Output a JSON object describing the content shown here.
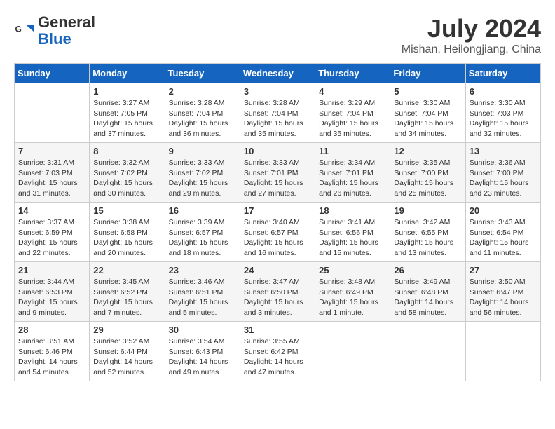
{
  "header": {
    "logo_line1": "General",
    "logo_line2": "Blue",
    "month": "July 2024",
    "location": "Mishan, Heilongjiang, China"
  },
  "days_of_week": [
    "Sunday",
    "Monday",
    "Tuesday",
    "Wednesday",
    "Thursday",
    "Friday",
    "Saturday"
  ],
  "weeks": [
    [
      {
        "day": "",
        "info": ""
      },
      {
        "day": "1",
        "info": "Sunrise: 3:27 AM\nSunset: 7:05 PM\nDaylight: 15 hours\nand 37 minutes."
      },
      {
        "day": "2",
        "info": "Sunrise: 3:28 AM\nSunset: 7:04 PM\nDaylight: 15 hours\nand 36 minutes."
      },
      {
        "day": "3",
        "info": "Sunrise: 3:28 AM\nSunset: 7:04 PM\nDaylight: 15 hours\nand 35 minutes."
      },
      {
        "day": "4",
        "info": "Sunrise: 3:29 AM\nSunset: 7:04 PM\nDaylight: 15 hours\nand 35 minutes."
      },
      {
        "day": "5",
        "info": "Sunrise: 3:30 AM\nSunset: 7:04 PM\nDaylight: 15 hours\nand 34 minutes."
      },
      {
        "day": "6",
        "info": "Sunrise: 3:30 AM\nSunset: 7:03 PM\nDaylight: 15 hours\nand 32 minutes."
      }
    ],
    [
      {
        "day": "7",
        "info": "Sunrise: 3:31 AM\nSunset: 7:03 PM\nDaylight: 15 hours\nand 31 minutes."
      },
      {
        "day": "8",
        "info": "Sunrise: 3:32 AM\nSunset: 7:02 PM\nDaylight: 15 hours\nand 30 minutes."
      },
      {
        "day": "9",
        "info": "Sunrise: 3:33 AM\nSunset: 7:02 PM\nDaylight: 15 hours\nand 29 minutes."
      },
      {
        "day": "10",
        "info": "Sunrise: 3:33 AM\nSunset: 7:01 PM\nDaylight: 15 hours\nand 27 minutes."
      },
      {
        "day": "11",
        "info": "Sunrise: 3:34 AM\nSunset: 7:01 PM\nDaylight: 15 hours\nand 26 minutes."
      },
      {
        "day": "12",
        "info": "Sunrise: 3:35 AM\nSunset: 7:00 PM\nDaylight: 15 hours\nand 25 minutes."
      },
      {
        "day": "13",
        "info": "Sunrise: 3:36 AM\nSunset: 7:00 PM\nDaylight: 15 hours\nand 23 minutes."
      }
    ],
    [
      {
        "day": "14",
        "info": "Sunrise: 3:37 AM\nSunset: 6:59 PM\nDaylight: 15 hours\nand 22 minutes."
      },
      {
        "day": "15",
        "info": "Sunrise: 3:38 AM\nSunset: 6:58 PM\nDaylight: 15 hours\nand 20 minutes."
      },
      {
        "day": "16",
        "info": "Sunrise: 3:39 AM\nSunset: 6:57 PM\nDaylight: 15 hours\nand 18 minutes."
      },
      {
        "day": "17",
        "info": "Sunrise: 3:40 AM\nSunset: 6:57 PM\nDaylight: 15 hours\nand 16 minutes."
      },
      {
        "day": "18",
        "info": "Sunrise: 3:41 AM\nSunset: 6:56 PM\nDaylight: 15 hours\nand 15 minutes."
      },
      {
        "day": "19",
        "info": "Sunrise: 3:42 AM\nSunset: 6:55 PM\nDaylight: 15 hours\nand 13 minutes."
      },
      {
        "day": "20",
        "info": "Sunrise: 3:43 AM\nSunset: 6:54 PM\nDaylight: 15 hours\nand 11 minutes."
      }
    ],
    [
      {
        "day": "21",
        "info": "Sunrise: 3:44 AM\nSunset: 6:53 PM\nDaylight: 15 hours\nand 9 minutes."
      },
      {
        "day": "22",
        "info": "Sunrise: 3:45 AM\nSunset: 6:52 PM\nDaylight: 15 hours\nand 7 minutes."
      },
      {
        "day": "23",
        "info": "Sunrise: 3:46 AM\nSunset: 6:51 PM\nDaylight: 15 hours\nand 5 minutes."
      },
      {
        "day": "24",
        "info": "Sunrise: 3:47 AM\nSunset: 6:50 PM\nDaylight: 15 hours\nand 3 minutes."
      },
      {
        "day": "25",
        "info": "Sunrise: 3:48 AM\nSunset: 6:49 PM\nDaylight: 15 hours\nand 1 minute."
      },
      {
        "day": "26",
        "info": "Sunrise: 3:49 AM\nSunset: 6:48 PM\nDaylight: 14 hours\nand 58 minutes."
      },
      {
        "day": "27",
        "info": "Sunrise: 3:50 AM\nSunset: 6:47 PM\nDaylight: 14 hours\nand 56 minutes."
      }
    ],
    [
      {
        "day": "28",
        "info": "Sunrise: 3:51 AM\nSunset: 6:46 PM\nDaylight: 14 hours\nand 54 minutes."
      },
      {
        "day": "29",
        "info": "Sunrise: 3:52 AM\nSunset: 6:44 PM\nDaylight: 14 hours\nand 52 minutes."
      },
      {
        "day": "30",
        "info": "Sunrise: 3:54 AM\nSunset: 6:43 PM\nDaylight: 14 hours\nand 49 minutes."
      },
      {
        "day": "31",
        "info": "Sunrise: 3:55 AM\nSunset: 6:42 PM\nDaylight: 14 hours\nand 47 minutes."
      },
      {
        "day": "",
        "info": ""
      },
      {
        "day": "",
        "info": ""
      },
      {
        "day": "",
        "info": ""
      }
    ]
  ]
}
